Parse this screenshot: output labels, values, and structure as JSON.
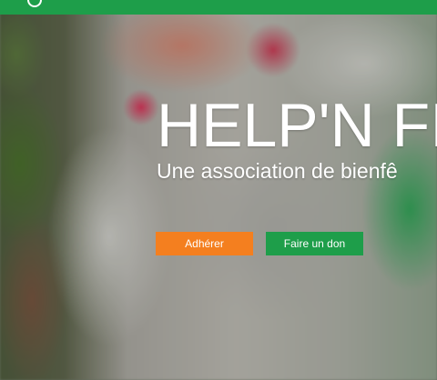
{
  "hero": {
    "title": "HELP'N FI",
    "subtitle": "Une association de bienfê"
  },
  "buttons": {
    "join_label": "Adhérer",
    "donate_label": "Faire un don"
  },
  "colors": {
    "brand_green": "#1e9e4a",
    "accent_orange": "#f47f1f"
  },
  "icons": {
    "logo": "logo-circle-icon"
  }
}
